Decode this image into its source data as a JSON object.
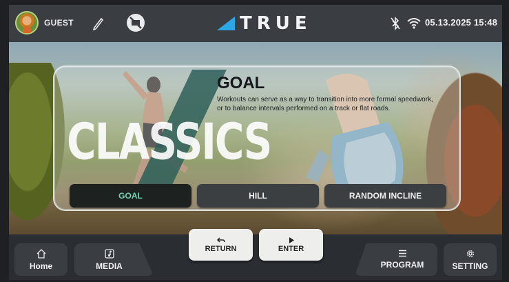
{
  "status_bar": {
    "user_name": "GUEST",
    "brand": "TRUE",
    "datetime": "05.13.2025 15:48"
  },
  "hero": {
    "watermark": "CLASSICS",
    "program_title": "GOAL",
    "program_description": "Workouts can serve as a way to transition into more formal speedwork, or to balance intervals performed on a track or flat roads.",
    "program_buttons": [
      {
        "label": "GOAL",
        "selected": true
      },
      {
        "label": "HILL",
        "selected": false
      },
      {
        "label": "RANDOM INCLINE",
        "selected": false
      }
    ]
  },
  "nav": {
    "home": "Home",
    "media": "MEDIA",
    "return": "RETURN",
    "enter": "ENTER",
    "program": "PROGRAM",
    "setting": "SETTING"
  },
  "icons": {
    "avatar": "avatar-icon",
    "edit": "pencil-icon",
    "no_service": "no-service-icon",
    "bluetooth": "bluetooth-off-icon",
    "wifi": "wifi-icon",
    "home": "home-icon",
    "media": "music-note-icon",
    "return": "undo-arrow-icon",
    "enter": "play-icon",
    "program": "list-icon",
    "setting": "gear-icon"
  },
  "colors": {
    "accent": "#6fd3b0",
    "logo_blue": "#2aa7e6",
    "bar": "#3a3d41"
  }
}
